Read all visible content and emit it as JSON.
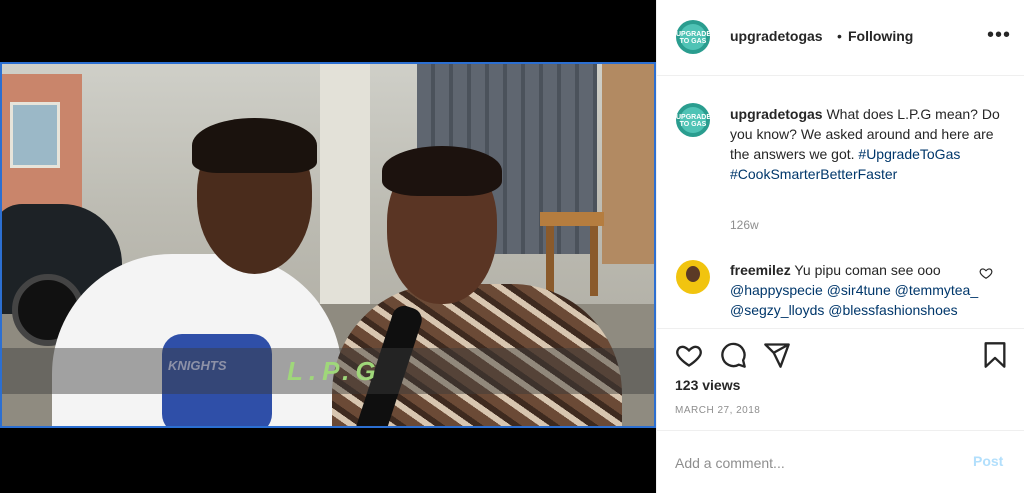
{
  "video": {
    "caption_overlay": "L.P.G",
    "shirt_text": "KNIGHTS"
  },
  "header": {
    "username": "upgradetogas",
    "separator": "•",
    "follow_state": "Following",
    "more_label": "•••",
    "avatar_text": "UPGRADE TO GAS"
  },
  "caption": {
    "username": "upgradetogas",
    "text": "What does L.P.G mean? Do you know? We asked around and here are the answers we got.",
    "hashtag1": "#UpgradeToGas",
    "hashtag2": "#CookSmarterBetterFaster",
    "time": "126w"
  },
  "comment": {
    "username": "freemilez",
    "text": "Yu pipu coman see ooo",
    "mention1": "@happyspecie",
    "mention2": "@sir4tune",
    "mention3": "@temmytea_",
    "mention4": "@segzy_lloyds",
    "mention5": "@blessfashionshoes"
  },
  "stats": {
    "views": "123 views",
    "date": "MARCH 27, 2018"
  },
  "add_comment": {
    "placeholder": "Add a comment...",
    "post_label": "Post"
  },
  "icons": [
    "heart-icon",
    "comment-icon",
    "share-icon",
    "bookmark-icon",
    "more-icon"
  ],
  "colors": {
    "link": "#00376b",
    "post_disabled": "#b2dffc",
    "muted": "#8e8e8e",
    "text": "#262626"
  }
}
